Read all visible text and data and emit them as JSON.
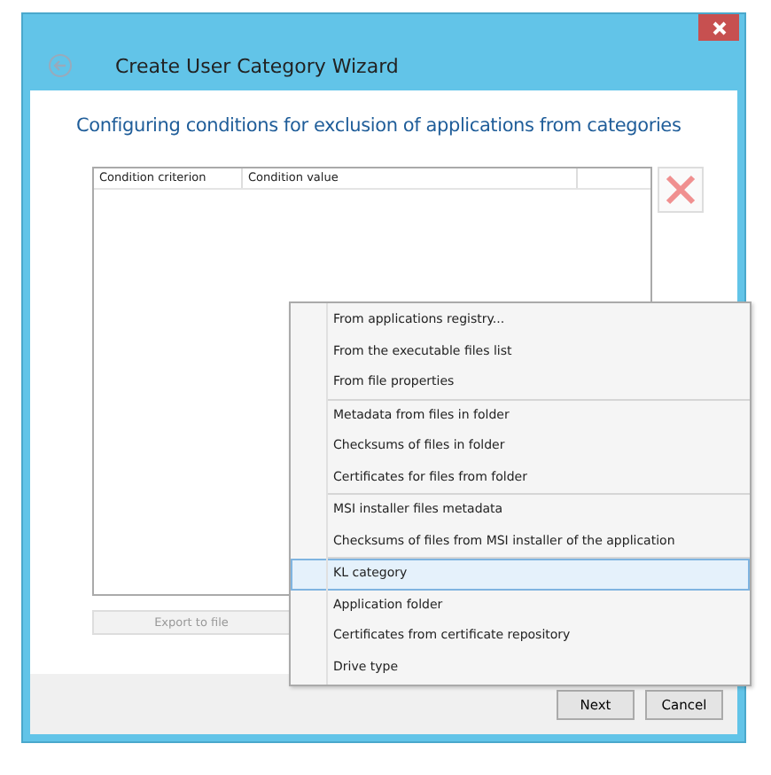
{
  "window": {
    "title": "Create User Category Wizard"
  },
  "heading": "Configuring conditions for exclusion of applications from categories",
  "table": {
    "columns": [
      "Condition criterion",
      "Condition value"
    ]
  },
  "export_button": {
    "label": "Export to file",
    "disabled": true
  },
  "context_menu": {
    "groups": [
      {
        "items": [
          {
            "label": "From applications registry...",
            "selected": false
          },
          {
            "label": "From the executable files list",
            "selected": false
          },
          {
            "label": "From file properties",
            "selected": false
          }
        ]
      },
      {
        "items": [
          {
            "label": "Metadata from files in folder",
            "selected": false
          },
          {
            "label": "Checksums of files in folder",
            "selected": false
          },
          {
            "label": "Certificates for files from folder",
            "selected": false
          }
        ]
      },
      {
        "items": [
          {
            "label": "MSI installer files metadata",
            "selected": false
          },
          {
            "label": "Checksums of files from MSI installer of the application",
            "selected": false
          }
        ]
      },
      {
        "items": [
          {
            "label": "KL category",
            "selected": true
          },
          {
            "label": "Application folder",
            "selected": false
          },
          {
            "label": "Certificates from certificate repository",
            "selected": false
          },
          {
            "label": "Drive type",
            "selected": false
          }
        ]
      }
    ]
  },
  "buttons": [
    "Next",
    "Cancel"
  ]
}
